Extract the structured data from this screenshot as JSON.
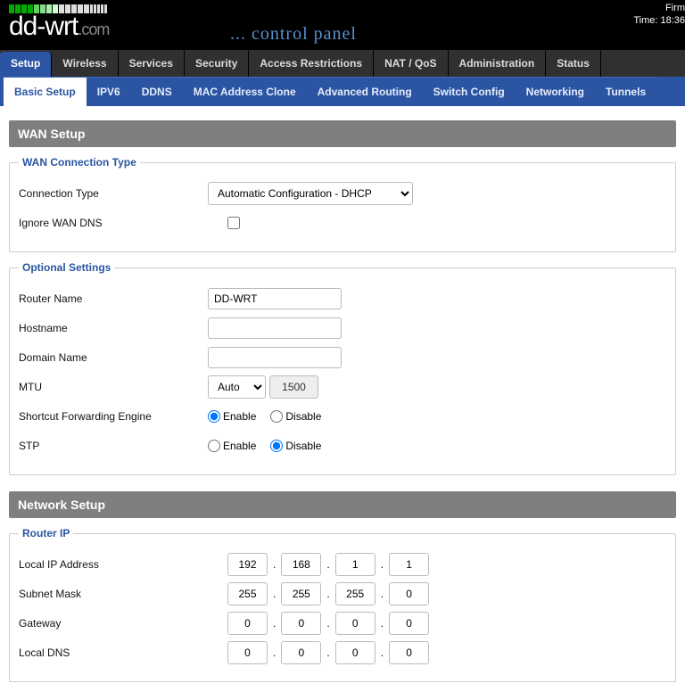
{
  "header": {
    "logo_text": "dd-wrt",
    "logo_suffix": ".com",
    "control_panel": "... control panel",
    "firm": "Firm",
    "time": "Time: 18:36"
  },
  "main_tabs": [
    "Setup",
    "Wireless",
    "Services",
    "Security",
    "Access Restrictions",
    "NAT / QoS",
    "Administration",
    "Status"
  ],
  "main_tab_active": 0,
  "sub_tabs": [
    "Basic Setup",
    "IPV6",
    "DDNS",
    "MAC Address Clone",
    "Advanced Routing",
    "Switch Config",
    "Networking",
    "Tunnels"
  ],
  "sub_tab_active": 0,
  "sections": {
    "wan_setup": "WAN Setup",
    "network_setup": "Network Setup"
  },
  "fieldsets": {
    "wan_conn": {
      "legend": "WAN Connection Type",
      "conn_type_label": "Connection Type",
      "conn_type_value": "Automatic Configuration - DHCP",
      "ignore_dns_label": "Ignore WAN DNS"
    },
    "optional": {
      "legend": "Optional Settings",
      "router_name_label": "Router Name",
      "router_name_value": "DD-WRT",
      "hostname_label": "Hostname",
      "hostname_value": "",
      "domain_label": "Domain Name",
      "domain_value": "",
      "mtu_label": "MTU",
      "mtu_mode": "Auto",
      "mtu_value": "1500",
      "sfe_label": "Shortcut Forwarding Engine",
      "stp_label": "STP",
      "enable": "Enable",
      "disable": "Disable"
    },
    "router_ip": {
      "legend": "Router IP",
      "local_ip_label": "Local IP Address",
      "local_ip": [
        "192",
        "168",
        "1",
        "1"
      ],
      "subnet_label": "Subnet Mask",
      "subnet": [
        "255",
        "255",
        "255",
        "0"
      ],
      "gateway_label": "Gateway",
      "gateway": [
        "0",
        "0",
        "0",
        "0"
      ],
      "dns_label": "Local DNS",
      "dns": [
        "0",
        "0",
        "0",
        "0"
      ]
    }
  }
}
